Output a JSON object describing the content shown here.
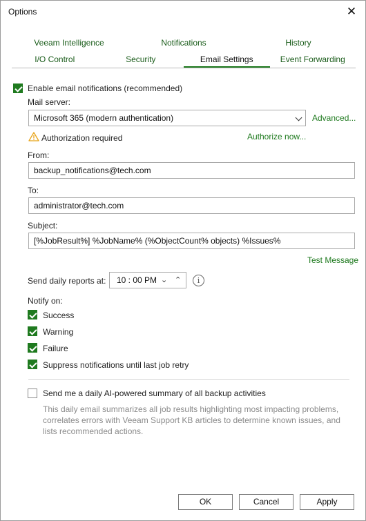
{
  "window": {
    "title": "Options"
  },
  "tabs_row1": [
    {
      "label": "Veeam Intelligence"
    },
    {
      "label": "Notifications"
    },
    {
      "label": "History"
    }
  ],
  "tabs_row2": [
    {
      "label": "I/O Control"
    },
    {
      "label": "Security"
    },
    {
      "label": "Email Settings",
      "active": true
    },
    {
      "label": "Event Forwarding"
    }
  ],
  "email": {
    "enable_label": "Enable email notifications (recommended)",
    "mail_server_label": "Mail server:",
    "mail_server_value": "Microsoft 365 (modern authentication)",
    "advanced_link": "Advanced...",
    "auth_required": "Authorization required",
    "authorize_link": "Authorize now...",
    "from_label": "From:",
    "from_value": "backup_notifications@tech.com",
    "to_label": "To:",
    "to_value": "administrator@tech.com",
    "subject_label": "Subject:",
    "subject_value": "[%JobResult%] %JobName% (%ObjectCount% objects) %Issues%",
    "test_link": "Test Message",
    "daily_label": "Send daily reports at:",
    "daily_time": "10 : 00 PM",
    "notify_label": "Notify on:",
    "notify_options": [
      {
        "label": "Success",
        "checked": true
      },
      {
        "label": "Warning",
        "checked": true
      },
      {
        "label": "Failure",
        "checked": true
      },
      {
        "label": "Suppress notifications until last job retry",
        "checked": true
      }
    ],
    "ai_summary_label": "Send me a daily AI-powered summary of all backup activities",
    "ai_summary_checked": false,
    "ai_summary_desc": "This daily email summarizes all job results highlighting most impacting problems, correlates errors with Veeam Support KB articles to determine known issues, and lists recommended actions."
  },
  "buttons": {
    "ok": "OK",
    "cancel": "Cancel",
    "apply": "Apply"
  },
  "colors": {
    "accent": "#1f7a1f",
    "link": "#1f7a1f",
    "warning": "#e8a317",
    "muted": "#8a8a8a"
  }
}
